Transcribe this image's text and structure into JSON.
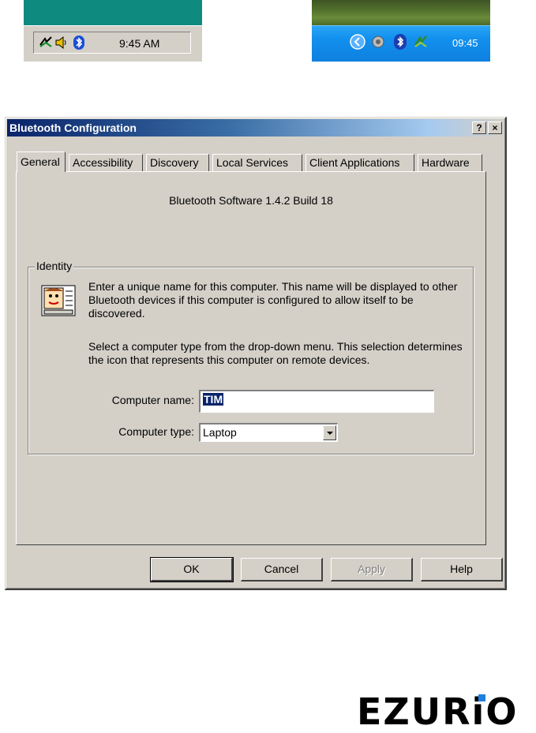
{
  "classic_tray": {
    "time": "9:45 AM"
  },
  "xp_tray": {
    "time": "09:45"
  },
  "dialog": {
    "title": "Bluetooth Configuration",
    "help_button": "?",
    "close_button": "×",
    "tabs": [
      "General",
      "Accessibility",
      "Discovery",
      "Local Services",
      "Client Applications",
      "Hardware"
    ],
    "active_tab": "General",
    "version": "Bluetooth Software 1.4.2 Build 18",
    "identity": {
      "label": "Identity",
      "para1": "Enter a unique name for this computer.  This name will be displayed to other Bluetooth devices if this computer is configured to allow itself to be discovered.",
      "para2": "Select a computer type from the drop-down menu.  This selection determines the icon that represents this computer on remote devices.",
      "name_label": "Computer name:",
      "name_value": "TIM",
      "type_label": "Computer type:",
      "type_value": "Laptop"
    },
    "buttons": {
      "ok": "OK",
      "cancel": "Cancel",
      "apply": "Apply",
      "help": "Help"
    }
  },
  "brand": "EZURiO",
  "colors": {
    "titlebar_start": "#0a246a",
    "face": "#d4d0c8",
    "classic_desktop": "#0f8a7f",
    "xp_taskbar": "#1290ee",
    "bluetooth": "#1a4fd6"
  }
}
